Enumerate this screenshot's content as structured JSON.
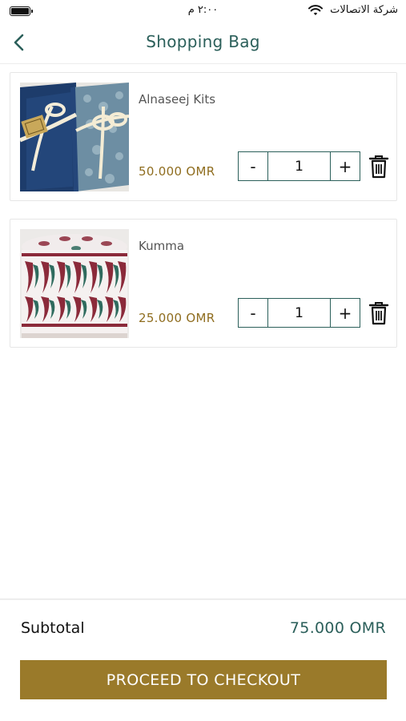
{
  "status_bar": {
    "time": "٢:٠٠ م",
    "carrier": "شركة الاتصالات",
    "icons": [
      "battery-icon",
      "wifi-icon"
    ]
  },
  "nav": {
    "title": "Shopping Bag",
    "back_icon": "chevron-left-icon"
  },
  "items": [
    {
      "name": "Alnaseej Kits",
      "price": "50.000 OMR",
      "quantity": "1",
      "minus_label": "-",
      "plus_label": "+",
      "delete_icon": "trash-icon"
    },
    {
      "name": "Kumma",
      "price": "25.000 OMR",
      "quantity": "1",
      "minus_label": "-",
      "plus_label": "+",
      "delete_icon": "trash-icon"
    }
  ],
  "footer": {
    "subtotal_label": "Subtotal",
    "subtotal_value": "75.000 OMR",
    "checkout_label": "PROCEED TO CHECKOUT"
  },
  "colors": {
    "primary": "#2b5f5a",
    "accent": "#9a7a2a",
    "price": "#8f6d1f"
  }
}
